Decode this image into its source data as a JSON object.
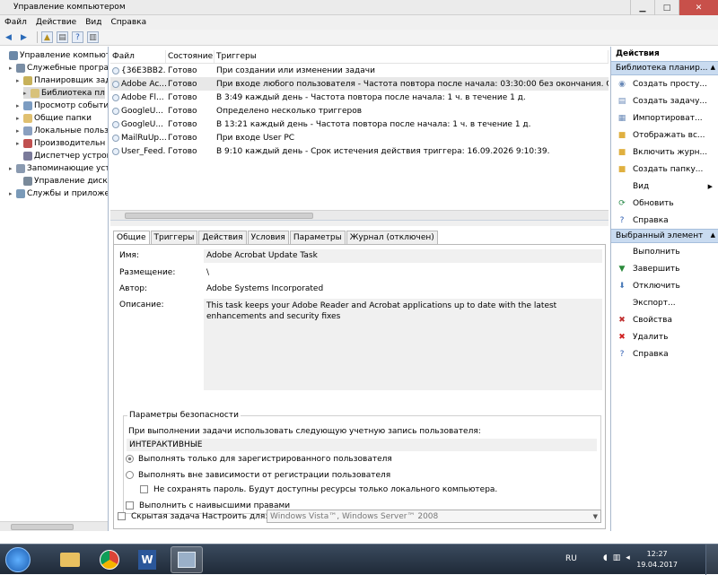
{
  "window": {
    "title": "Управление компьютером"
  },
  "menu": [
    "Файл",
    "Действие",
    "Вид",
    "Справка"
  ],
  "tree": [
    {
      "label": "Управление компьютер",
      "indent": 0,
      "toggle": "",
      "color": "#6b88a8"
    },
    {
      "label": "Служебные програм",
      "indent": 1,
      "toggle": "▸",
      "color": "#7a8ea5"
    },
    {
      "label": "Планировщик зад",
      "indent": 2,
      "toggle": "▸",
      "color": "#c7b15a"
    },
    {
      "label": "Библиотека пл",
      "indent": 3,
      "toggle": "▸",
      "color": "#d8c27a",
      "selected": true
    },
    {
      "label": "Просмотр событи",
      "indent": 2,
      "toggle": "▸",
      "color": "#7c9cc2"
    },
    {
      "label": "Общие папки",
      "indent": 2,
      "toggle": "▸",
      "color": "#e0c070"
    },
    {
      "label": "Локальные польз",
      "indent": 2,
      "toggle": "▸",
      "color": "#8aa0c0"
    },
    {
      "label": "Производительн",
      "indent": 2,
      "toggle": "▸",
      "color": "#c05050"
    },
    {
      "label": "Диспетчер устрой",
      "indent": 2,
      "toggle": "",
      "color": "#7a7a9a"
    },
    {
      "label": "Запоминающие устр",
      "indent": 1,
      "toggle": "▸",
      "color": "#8a9ab0"
    },
    {
      "label": "Управление диска",
      "indent": 2,
      "toggle": "",
      "color": "#7a8a9a"
    },
    {
      "label": "Службы и приложен",
      "indent": 1,
      "toggle": "▸",
      "color": "#7a9ab8"
    }
  ],
  "tasks": {
    "headers": [
      "Файл",
      "Состояние",
      "Триггеры"
    ],
    "rows": [
      {
        "name": "{36E3BB2...",
        "status": "Готово",
        "trigger": "При создании или изменении задачи"
      },
      {
        "name": "Adobe Ac...",
        "status": "Готово",
        "trigger": "При входе любого пользователя - Частота повтора после начала: 03:30:00 без окончания. Срок ист",
        "selected": true
      },
      {
        "name": "Adobe Fl...",
        "status": "Готово",
        "trigger": "В 3:49 каждый день - Частота повтора после начала: 1 ч. в течение 1 д."
      },
      {
        "name": "GoogleU...",
        "status": "Готово",
        "trigger": "Определено несколько триггеров"
      },
      {
        "name": "GoogleU...",
        "status": "Готово",
        "trigger": "В 13:21 каждый день - Частота повтора после начала: 1 ч. в течение 1 д."
      },
      {
        "name": "MailRuUp...",
        "status": "Готово",
        "trigger": "При входе User PC"
      },
      {
        "name": "User_Feed...",
        "status": "Готово",
        "trigger": "В 9:10 каждый день - Срок истечения действия триггера: 16.09.2026 9:10:39."
      }
    ]
  },
  "tabs": [
    "Общие",
    "Триггеры",
    "Действия",
    "Условия",
    "Параметры",
    "Журнал (отключен)"
  ],
  "general": {
    "name_label": "Имя:",
    "name_value": "Adobe Acrobat Update Task",
    "location_label": "Размещение:",
    "location_value": "\\",
    "author_label": "Автор:",
    "author_value": "Adobe Systems Incorporated",
    "description_label": "Описание:",
    "description_value": "This task keeps your Adobe Reader and Acrobat applications up to date with the latest enhancements and security fixes"
  },
  "security": {
    "title": "Параметры безопасности",
    "account_prompt": "При выполнении задачи использовать следующую учетную запись пользователя:",
    "account": "ИНТЕРАКТИВНЫЕ",
    "radio1": "Выполнять только для зарегистрированного пользователя",
    "radio2": "Выполнять вне зависимости от регистрации пользователя",
    "nosave": "Не сохранять пароль. Будут доступны ресурсы только локального компьютера.",
    "highest": "Выполнить с наивысшими правами"
  },
  "footer": {
    "hidden": "Скрытая задача",
    "configure_label": "Настроить для:",
    "configure_value": "Windows Vista™, Windows Server™ 2008"
  },
  "actions": {
    "header": "Действия",
    "section1": "Библиотека планир...",
    "items1": [
      {
        "label": "Создать просту...",
        "icon": "create-basic-icon",
        "glyph": "◉",
        "color": "#6a8ab8"
      },
      {
        "label": "Создать задачу...",
        "icon": "create-task-icon",
        "glyph": "▤",
        "color": "#6a8ab8"
      },
      {
        "label": "Импортироват...",
        "icon": "import-icon",
        "glyph": "▦",
        "color": "#6a8ab8"
      },
      {
        "label": "Отображать вс...",
        "icon": "folder-icon",
        "glyph": "■",
        "color": "#e0b040"
      },
      {
        "label": "Включить журн...",
        "icon": "log-icon",
        "glyph": "■",
        "color": "#e0b040"
      },
      {
        "label": "Создать папку...",
        "icon": "new-folder-icon",
        "glyph": "■",
        "color": "#e0b040"
      },
      {
        "label": "Вид",
        "icon": "view-icon",
        "glyph": "",
        "color": "#000000",
        "submenu": true
      },
      {
        "label": "Обновить",
        "icon": "refresh-icon",
        "glyph": "⟳",
        "color": "#2a8a4a"
      },
      {
        "label": "Справка",
        "icon": "help-icon",
        "glyph": "?",
        "color": "#2a5ab0"
      }
    ],
    "section2": "Выбранный элемент",
    "items2": [
      {
        "label": "Выполнить",
        "icon": "",
        "glyph": "",
        "color": "#000000"
      },
      {
        "label": "Завершить",
        "icon": "stop-icon",
        "glyph": "▼",
        "color": "#2a8a3a"
      },
      {
        "label": "Отключить",
        "icon": "disable-icon",
        "glyph": "⬇",
        "color": "#4a7ab8"
      },
      {
        "label": "Экспорт...",
        "icon": "",
        "glyph": "",
        "color": "#000000"
      },
      {
        "label": "Свойства",
        "icon": "properties-icon",
        "glyph": "✖",
        "color": "#c03030"
      },
      {
        "label": "Удалить",
        "icon": "delete-icon",
        "glyph": "✖",
        "color": "#d02020"
      },
      {
        "label": "Справка",
        "icon": "help-icon",
        "glyph": "?",
        "color": "#2a5ab0"
      }
    ]
  },
  "taskbar": {
    "lang": "RU",
    "time": "12:27",
    "date": "19.04.2017"
  }
}
